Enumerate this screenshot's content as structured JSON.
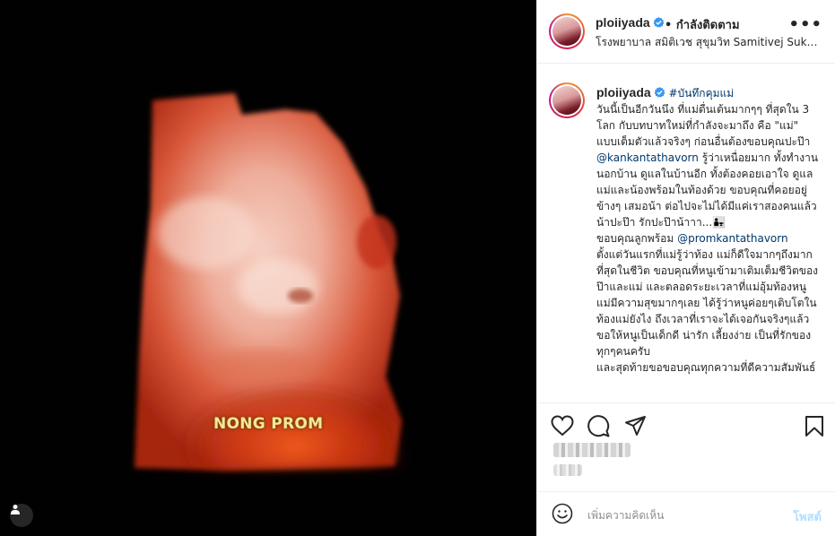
{
  "post": {
    "image_caption": "NONG PROM",
    "image_icons": {
      "user_tag": "user-tag-icon"
    }
  },
  "header": {
    "username": "ploiiyada",
    "follow_status": "• กำลังติดตาม",
    "location": "โรงพยาบาล สมิติเวช สุขุมวิท Samitivej Sukhumvit Hospital",
    "more": "•••",
    "verified_color": "#3897f0"
  },
  "caption": {
    "username": "ploiiyada",
    "hashtag": "#บันทึกคุมแม่",
    "text_1": "วันนี้เป็นอีกวันนึง ที่แม่ตื่นเต้นมากๆๆ ที่สุดใน 3 โลก กับบทบาทใหม่ที่กำลังจะมาถึง คือ \"แม่\" แบบเต็มตัวแล้วจริงๆ ก่อนอื่นต้องขอบคุณปะป๊า ",
    "mention_1": "@kankantathavorn",
    "text_2": " รู้ว่าเหนื่อยมาก ทั้งทำงาน นอกบ้าน ดูแลในบ้านอีก ทั้งต้องคอยเอาใจ ดูแลแม่และน้องพร้อมในท้องด้วย ขอบคุณที่คอยอยู่ข้างๆ เสมอน้า ต่อไปจะไม่ได้มีแค่เราสองคนแล้วน้าปะป๊า รักปะป๊าน้าาา...👨‍👧\nขอบคุณลูกพร้อม ",
    "mention_2": "@promkantathavorn",
    "text_3": "\nตั้งแต่วันแรกที่แม่รู้ว่าท้อง แม่ก็ดีใจมากๆถึงมากที่สุดในชีวิต ขอบคุณที่หนูเข้ามาเติมเต็มชีวิตของป๊าและแม่ และตลอดระยะเวลาที่แม่อุ้มท้องหนู แม่มีความสุขมากๆเลย ได้รู้ว่าหนูค่อยๆเติบโตในท้องแม่ยังไง ถึงเวลาที่เราจะได้เจอกันจริงๆแล้ว ขอให้หนูเป็นเด็กดี น่ารัก เลี้ยงง่าย เป็นที่รักของทุกๆคนครับ\nและสุดท้ายขอขอบคุณทุกความที่ดีความสัมพันธ์"
  },
  "actions": {
    "like": "heart-icon",
    "comment": "comment-icon",
    "share": "share-icon",
    "save": "bookmark-icon"
  },
  "add_comment": {
    "placeholder": "เพิ่มความคิดเห็น",
    "post_label": "โพสต์"
  }
}
